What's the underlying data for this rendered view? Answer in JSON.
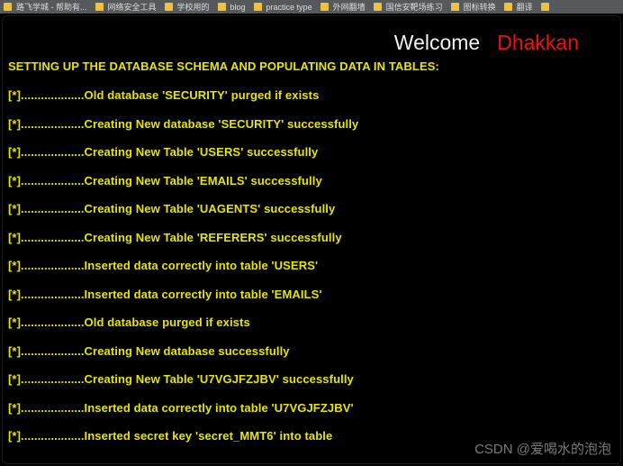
{
  "bookmarks_bar": {
    "items": [
      {
        "label": "路飞学城 - 帮助有...",
        "icon": "folder-icon"
      },
      {
        "label": "网络安全工具",
        "icon": "folder-icon"
      },
      {
        "label": "学校用的",
        "icon": "folder-icon"
      },
      {
        "label": "blog",
        "icon": "folder-icon"
      },
      {
        "label": "practice type",
        "icon": "folder-icon"
      },
      {
        "label": "外网翻墙",
        "icon": "folder-icon"
      },
      {
        "label": "国信安靶场练习",
        "icon": "folder-icon"
      },
      {
        "label": "图标转换",
        "icon": "folder-icon"
      },
      {
        "label": "翻译",
        "icon": "folder-icon"
      },
      {
        "label": "",
        "icon": "folder-icon"
      }
    ]
  },
  "header": {
    "welcome_label": "Welcome",
    "user_name": "Dhakkan"
  },
  "log": {
    "heading": "SETTING UP THE DATABASE SCHEMA AND POPULATING DATA IN TABLES:",
    "lines": [
      "[*]...................Old database 'SECURITY' purged if exists",
      "[*]...................Creating New database 'SECURITY' successfully",
      "[*]...................Creating New Table 'USERS' successfully",
      "[*]...................Creating New Table 'EMAILS' successfully",
      "[*]...................Creating New Table 'UAGENTS' successfully",
      "[*]...................Creating New Table 'REFERERS' successfully",
      "[*]...................Inserted data correctly into table 'USERS'",
      "[*]...................Inserted data correctly into table 'EMAILS'",
      "[*]...................Old database purged if exists",
      "[*]...................Creating New database successfully",
      "[*]...................Creating New Table 'U7VGJFZJBV' successfully",
      "[*]...................Inserted data correctly into table 'U7VGJFZJBV'",
      "[*]...................Inserted secret key 'secret_MMT6' into table"
    ]
  },
  "watermark": {
    "text": "CSDN @爱喝水的泡泡"
  },
  "colors": {
    "page_background": "#000000",
    "log_text": "#e6e600",
    "user_name": "#f01010",
    "welcome_text": "#f2f2f2",
    "bookmarks_bar_background": "#56595c",
    "bookmark_icon": "#f0c040",
    "watermark_text": "#7a7a7a"
  }
}
